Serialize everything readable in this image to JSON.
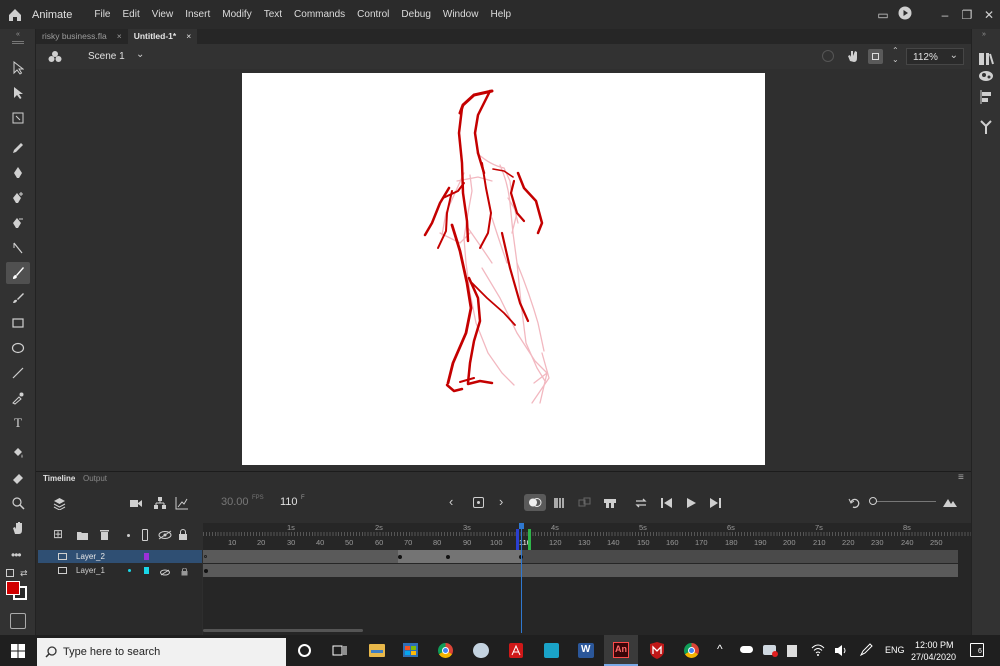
{
  "app": {
    "name": "Animate",
    "menus": [
      "File",
      "Edit",
      "View",
      "Insert",
      "Modify",
      "Text",
      "Commands",
      "Control",
      "Debug",
      "Window",
      "Help"
    ]
  },
  "tabs": [
    {
      "label": "risky business.fla",
      "close": "×"
    },
    {
      "label": "Untitled-1*",
      "close": "×"
    }
  ],
  "scene": {
    "label": "Scene 1",
    "zoom": "112%"
  },
  "timeline": {
    "tab_timeline": "Timeline",
    "tab_output": "Output",
    "fps": "30.00",
    "fps_unit": "FPS",
    "frame": "110",
    "frame_unit": "F",
    "seconds": [
      "1s",
      "2s",
      "3s",
      "4s",
      "5s",
      "6s",
      "7s",
      "8s"
    ],
    "frame_ticks": [
      "10",
      "20",
      "30",
      "40",
      "50",
      "60",
      "70",
      "80",
      "90",
      "100",
      "110",
      "120",
      "130",
      "140",
      "150",
      "160",
      "170",
      "180",
      "190",
      "200",
      "210",
      "220",
      "230",
      "240",
      "250"
    ],
    "layers": [
      {
        "name": "Layer_2",
        "color": "#9b30d8",
        "selected": true
      },
      {
        "name": "Layer_1",
        "color": "#19d7e8",
        "selected": false
      }
    ]
  },
  "taskbar": {
    "search_placeholder": "Type here to search",
    "language": "ENG",
    "time": "12:00 PM",
    "date": "27/04/2020",
    "notifications": "6"
  },
  "colors": {
    "accent": "#2f78d0",
    "stroke_color": "#d10000",
    "playhead": "#2f78d0"
  }
}
